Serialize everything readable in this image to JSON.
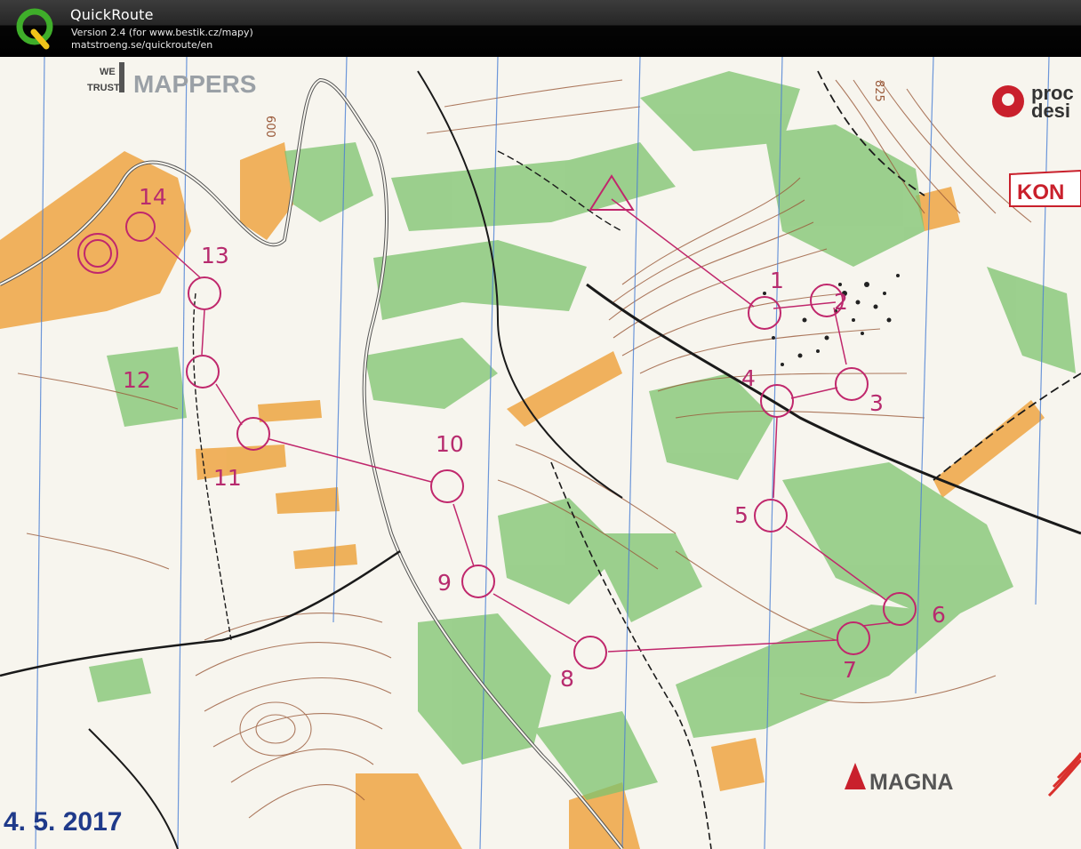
{
  "app": {
    "title": "QuickRoute",
    "version_line": "Version 2.4  (for www.bestik.cz/mapy)",
    "url_line": "matstroeng.se/quickroute/en"
  },
  "map": {
    "date_text": "4. 5. 2017",
    "contour_label_600": "600",
    "contour_label_825": "825",
    "sponsors": {
      "we_trust_line1": "WE",
      "we_trust_line2": "TRUST",
      "mappers": "MAPPERS",
      "proc_line1": "proc",
      "proc_line2": "desi",
      "kon": "KON",
      "magna": "MAGNA"
    },
    "controls": [
      {
        "id": "1",
        "label": "1"
      },
      {
        "id": "2",
        "label": "2"
      },
      {
        "id": "3",
        "label": "3"
      },
      {
        "id": "4",
        "label": "4"
      },
      {
        "id": "5",
        "label": "5"
      },
      {
        "id": "6",
        "label": "6"
      },
      {
        "id": "7",
        "label": "7"
      },
      {
        "id": "8",
        "label": "8"
      },
      {
        "id": "9",
        "label": "9"
      },
      {
        "id": "10",
        "label": "10"
      },
      {
        "id": "11",
        "label": "11"
      },
      {
        "id": "12",
        "label": "12"
      },
      {
        "id": "13",
        "label": "13"
      },
      {
        "id": "14",
        "label": "14"
      }
    ],
    "colors": {
      "course": "#c0276c",
      "forest_green": "#7dc36d",
      "open_yellow": "#eeaa4c",
      "contour_brown": "#9a5a3a",
      "water_blue": "#4a7fd4"
    }
  }
}
